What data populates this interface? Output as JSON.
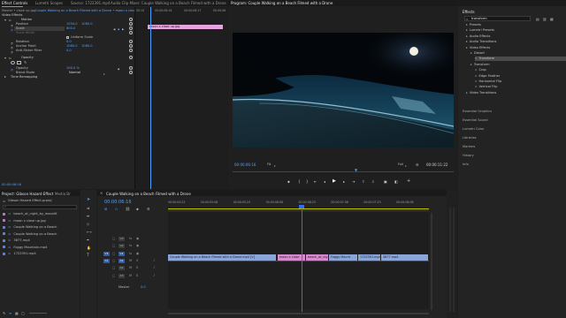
{
  "top_tabs": {
    "effect_controls": "Effect Controls",
    "lumetri_scopes": "Lumetri Scopes",
    "source": "Source: 1722391.mp4",
    "audio_clip_mixer": "Audio Clip Mixer: Couple Walking on a Beach Filmed with a Drone",
    "program": "Program: Couple Walking on a Beach Filmed with a Drone",
    "effects": "Effects"
  },
  "effect_controls": {
    "master": "Master • close up.jpg",
    "clip": "Couple Walking on a Beach Filmed with a Drone • moon x close up.jpg",
    "video_effects": "Video Effects",
    "motion": "Motion",
    "position_label": "Position",
    "position_x": "1034.0",
    "position_y": "1080.0",
    "scale_label": "Scale",
    "scale_value": "800.0",
    "scale_width_label": "Scale Width",
    "uniform_scale": "Uniform Scale",
    "rotation_label": "Rotation",
    "rotation_value": "0.0",
    "anchor_label": "Anchor Point",
    "anchor_x": "1080.0",
    "anchor_y": "1080.0",
    "antiflicker_label": "Anti-flicker Filter",
    "antiflicker_value": "0.0",
    "opacity": "Opacity",
    "opacity_label": "Opacity",
    "opacity_value": "100.0 %",
    "blend_label": "Blend Mode",
    "blend_value": "Normal",
    "time_remapping": "Time Remapping",
    "mini_clip": "moon x close up.jpg",
    "mini_ruler": [
      "00:15",
      "00:00:06:16",
      "00:00:06:17",
      "00:00:06"
    ],
    "bottom_time": "00:00:06:16"
  },
  "program": {
    "timecode": "00:00:06:16",
    "fit": "Fit",
    "quality": "Full",
    "duration": "00:00:11:22"
  },
  "effects_panel": {
    "search_value": "transform",
    "tree": [
      {
        "label": "Presets",
        "indent": 1
      },
      {
        "label": "Lumetri Presets",
        "indent": 1
      },
      {
        "label": "Audio Effects",
        "indent": 1
      },
      {
        "label": "Audio Transitions",
        "indent": 1
      },
      {
        "label": "Video Effects",
        "indent": 1
      },
      {
        "label": "Distort",
        "indent": 2
      },
      {
        "label": "Transform",
        "indent": 3
      },
      {
        "label": "Transform",
        "indent": 2
      },
      {
        "label": "Crop",
        "indent": 3
      },
      {
        "label": "Edge Feather",
        "indent": 3
      },
      {
        "label": "Horizontal Flip",
        "indent": 3
      },
      {
        "label": "Vertical Flip",
        "indent": 3
      },
      {
        "label": "Video Transitions",
        "indent": 1
      }
    ],
    "sections": [
      "Essential Graphics",
      "Essential Sound",
      "Lumetri Color",
      "Libraries",
      "Markers",
      "History",
      "Info"
    ]
  },
  "project": {
    "tab": "Project: Gibson Hazard Effect",
    "media_tab": "Media Br",
    "bin": "Gibson Hazard Effect.prproj",
    "items": [
      {
        "name": "beach_at_night_by_moonlit",
        "color": "#c46bd0"
      },
      {
        "name": "moon x close up.jpg",
        "color": "#c46bd0"
      },
      {
        "name": "Couple Walking on a Beach",
        "color": "#5a7fd6"
      },
      {
        "name": "Couple Walking on a Beach",
        "color": "#5a7fd6"
      },
      {
        "name": "3877.mp4",
        "color": "#5a7fd6"
      },
      {
        "name": "Foggy Mountain.mp4",
        "color": "#5a7fd6"
      },
      {
        "name": "1722391.mp4",
        "color": "#5a7fd6"
      }
    ]
  },
  "timeline": {
    "tab": "Couple Walking on a Beach Filmed with a Drone",
    "timecode": "00:00:06:16",
    "ruler": [
      "00:00:04:23",
      "00:00:05:08",
      "00:00:05:23",
      "00:00:06:08",
      "00:00:06:23",
      "00:00:07:08",
      "00:00:07:23",
      "00:00:08:08"
    ],
    "track_labels": [
      "V3",
      "V2",
      "V1",
      "A1",
      "A2",
      "A3"
    ],
    "master_label": "Master",
    "master_value": "0.0",
    "source_patch_v": "V1",
    "source_patch_a": "A1",
    "clips": [
      {
        "name": "Couple Walking on a Beach Filmed with a Drone.mp4 [V]",
        "color": "#8aa5d8"
      },
      {
        "name": "moon x close",
        "color": "#d88ad1"
      },
      {
        "name": "beach_at_nig",
        "color": "#d88ad1"
      },
      {
        "name": "Foggy Mount",
        "color": "#8aa5d8"
      },
      {
        "name": "1722391.mp4",
        "color": "#8aa5d8"
      },
      {
        "name": "3877.mp4",
        "color": "#8aa5d8"
      }
    ]
  },
  "colors": {
    "accent": "#4ea1ff",
    "playhead": "#2f6bff",
    "video_clip": "#8aa5d8",
    "image_clip": "#d88ad1"
  }
}
